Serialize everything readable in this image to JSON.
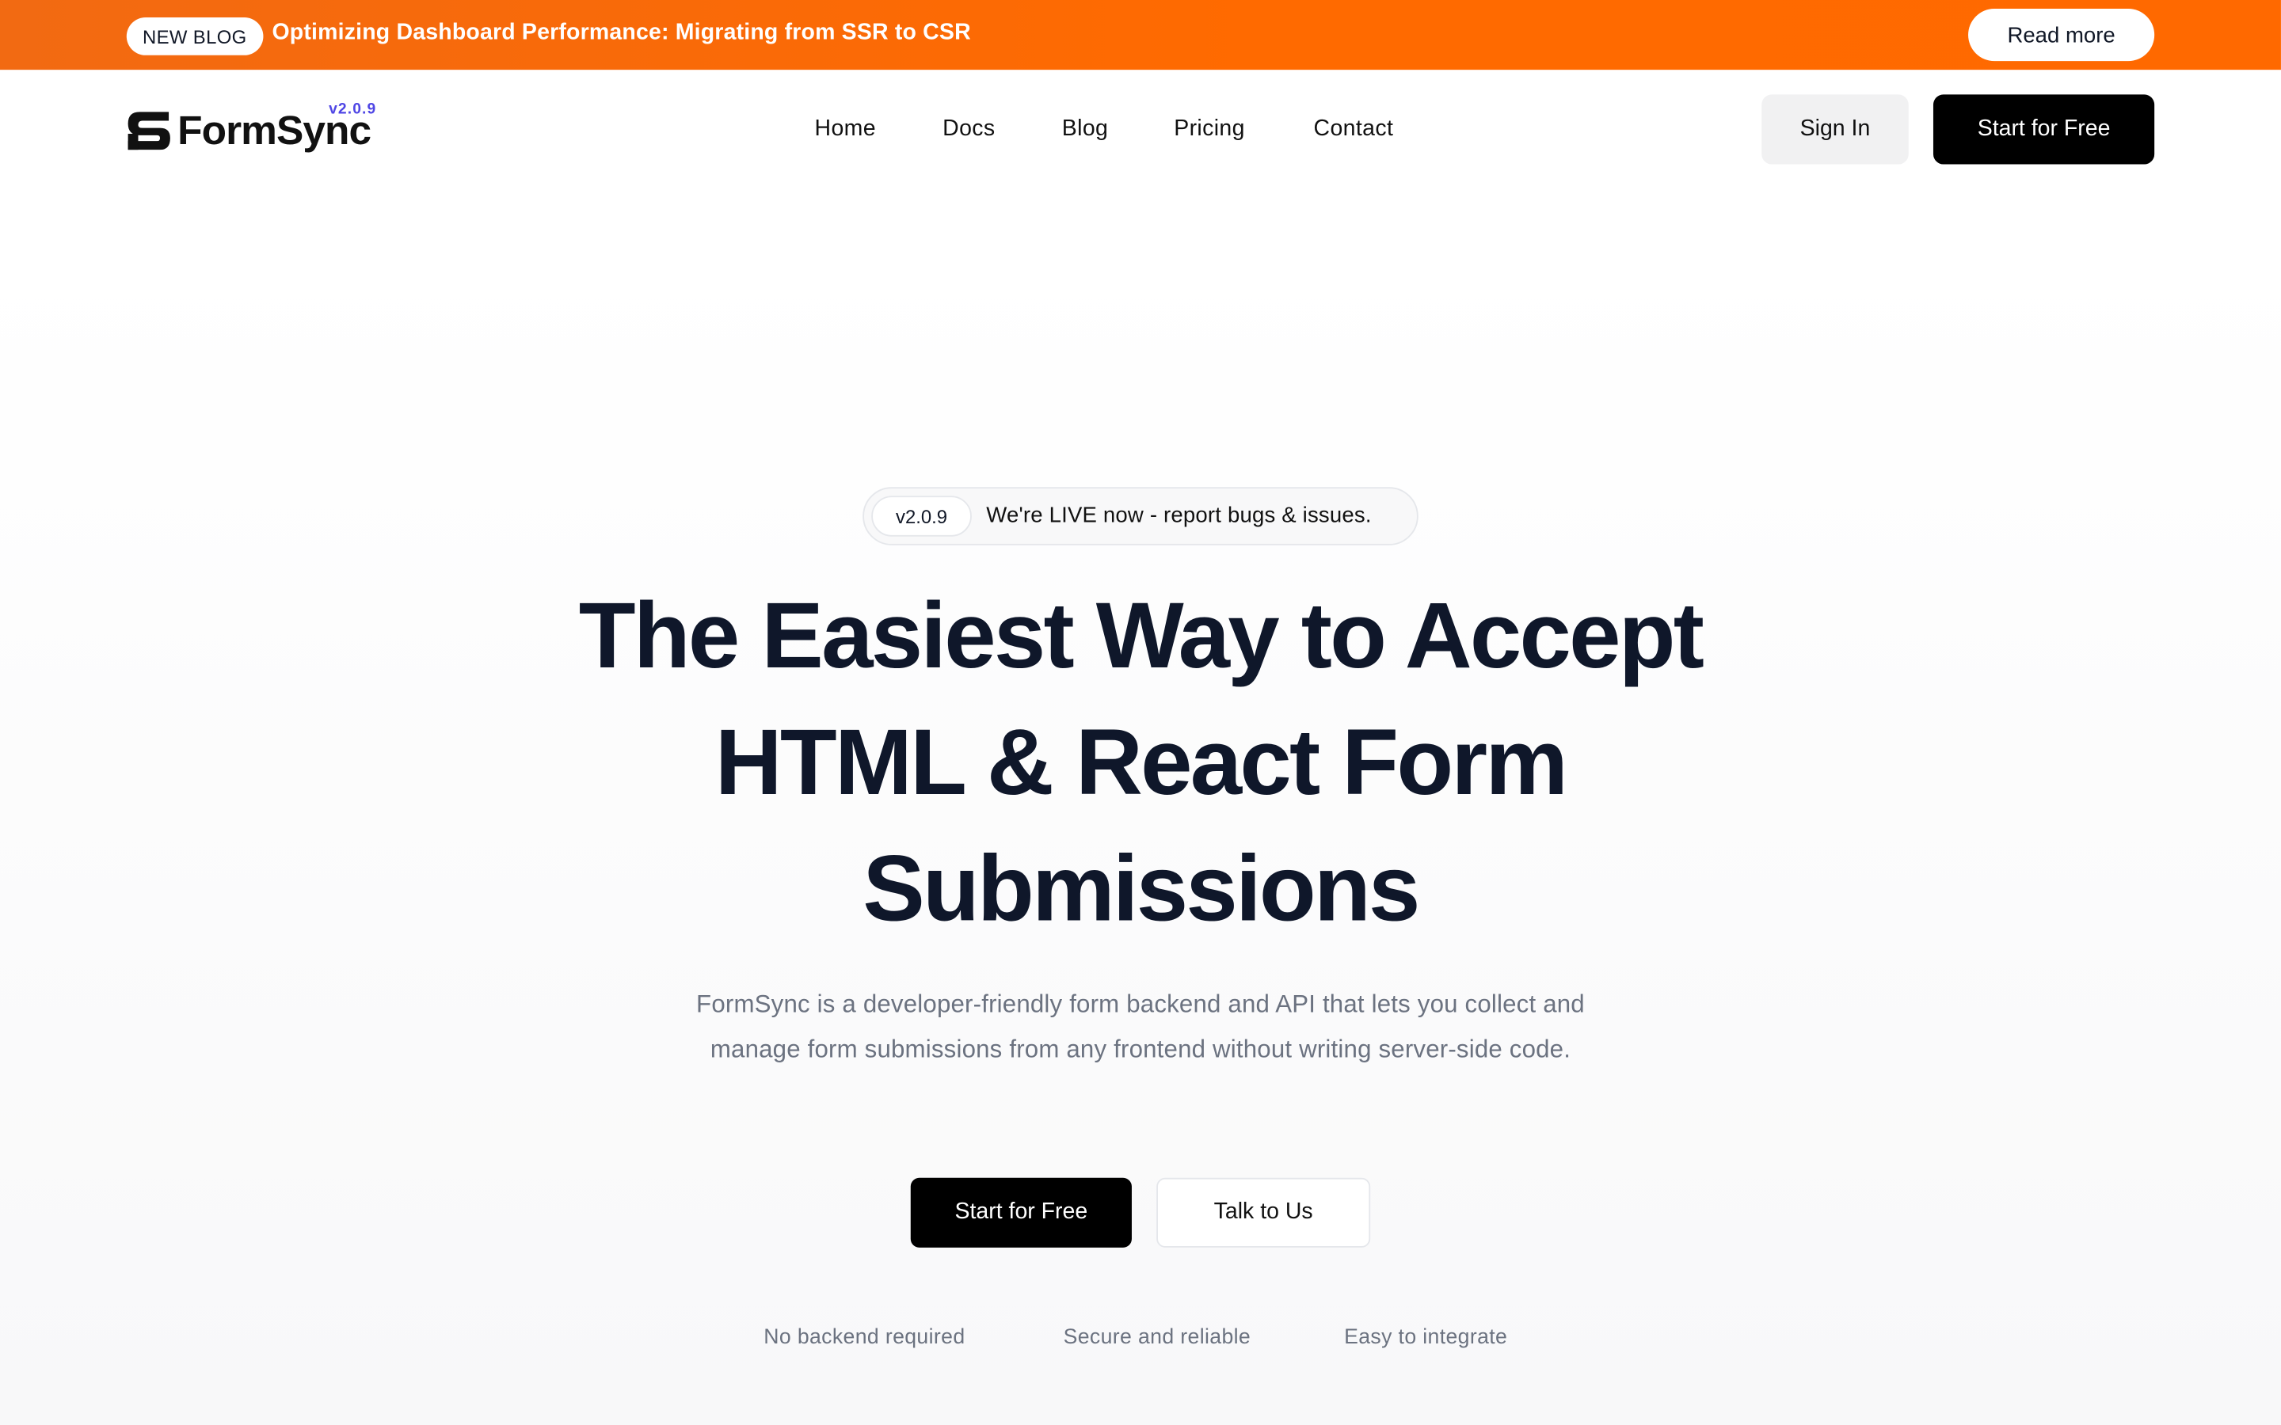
{
  "announcement": {
    "badge": "NEW BLOG",
    "text": "Optimizing Dashboard Performance: Migrating from SSR to CSR",
    "button_label": "Read more",
    "gradient_start": "#f26a12",
    "gradient_end": "#ff6900"
  },
  "header": {
    "logo_text": "FormSync",
    "logo_version": "v2.0.9",
    "logo_icon": "formsync-logo-mark",
    "nav": [
      {
        "label": "Home"
      },
      {
        "label": "Docs"
      },
      {
        "label": "Blog"
      },
      {
        "label": "Pricing"
      },
      {
        "label": "Contact"
      }
    ],
    "signin_label": "Sign In",
    "start_label": "Start for Free"
  },
  "hero": {
    "pill_version": "v2.0.9",
    "pill_text": "We're LIVE now - report bugs & issues.",
    "title_lines": [
      "The Easiest Way to Accept",
      "HTML & React Form",
      "Submissions"
    ],
    "description": "FormSync is a developer-friendly form backend and API that lets you collect and manage form submissions from any frontend without writing server-side code.",
    "primary_cta": "Start for Free",
    "secondary_cta": "Talk to Us",
    "features": [
      "No backend required",
      "Secure and reliable",
      "Easy to integrate"
    ]
  },
  "colors": {
    "accent": "#ff6a00",
    "version_accent": "#4f46e5",
    "primary_button": "#000000",
    "text_dark": "#0f172a",
    "text_muted": "#6b7280"
  }
}
